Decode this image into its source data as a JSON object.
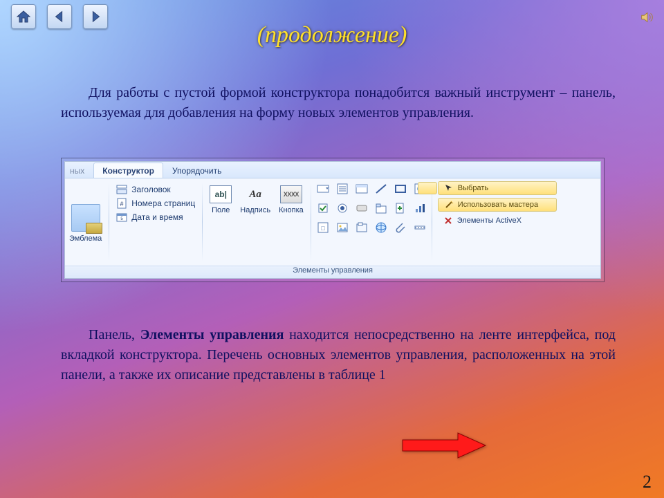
{
  "nav": {
    "home": "home-icon",
    "prev": "prev-icon",
    "next": "next-icon"
  },
  "title": "(продолжение)",
  "paragraph1_indent": "Для работы с пустой формой конструктора понадобится важный инструмент – панель, используемая для добавления на форму новых элементов управления.",
  "paragraph2_lead": "Панель,  ",
  "paragraph2_bold": "Элементы управления",
  "paragraph2_rest": " находится непосредственно на ленте интерфейса, под вкладкой конструктора. Перечень основных элементов управления, расположенных на этой панели, а также их описание представлены в таблице 1",
  "ribbon": {
    "tabs": {
      "cut": "ных",
      "active": "Конструктор",
      "other": "Упорядочить"
    },
    "emblem": "Эмблема",
    "header_items": {
      "title": "Заголовок",
      "pages": "Номера страниц",
      "datetime": "Дата и время"
    },
    "fields": {
      "field": "Поле",
      "label": "Надпись",
      "button": "Кнопка",
      "field_glyph": "ab|",
      "label_glyph": "Aa",
      "button_glyph": "XXXX"
    },
    "right": {
      "select": "Выбрать",
      "wizard": "Использовать мастера",
      "activex": "Элементы ActiveX"
    },
    "caption": "Элементы управления"
  },
  "page_number": "2"
}
